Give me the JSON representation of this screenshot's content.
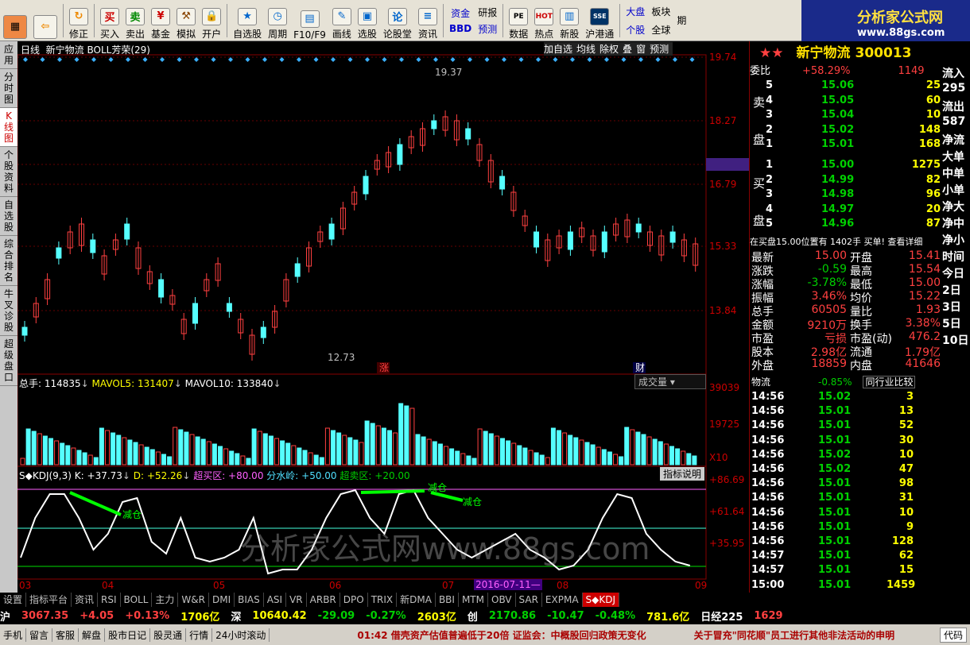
{
  "toolbar": {
    "buttons": [
      "修正",
      "买入",
      "卖出",
      "基金",
      "模拟",
      "开户",
      "自选股",
      "周期",
      "F10/F9",
      "画线",
      "选股",
      "论股堂",
      "资讯",
      "资金",
      "BBD",
      "研报",
      "预测",
      "数据",
      "热点",
      "新股",
      "沪港通",
      "大盘",
      "个股",
      "板块",
      "全球",
      "期"
    ],
    "brand": "分析家公式网",
    "brand_url": "www.88gs.com"
  },
  "leftnav": [
    "应用",
    "分时图",
    "K线图",
    "个股资料",
    "自选股",
    "综合排名",
    "牛叉诊股",
    "超级盘口"
  ],
  "chart": {
    "period": "日线",
    "name": "新宁物流",
    "indicator": "BOLL芳荣(29)",
    "tools": [
      "加自选",
      "均线",
      "除权",
      "叠",
      "窗",
      "预测"
    ],
    "price_axis": [
      "19.74",
      "18.27",
      "17.22",
      "16.79",
      "15.33",
      "13.84"
    ],
    "high_label": "19.37",
    "low_label": "12.73",
    "marks": [
      "涨",
      "财"
    ],
    "vol_header": {
      "total": "总手: 114835",
      "ma5": "MAVOL5: 131407",
      "ma10": "MAVOL10: 133840"
    },
    "vol_select": "成交量",
    "vol_axis": [
      "39039",
      "19725",
      "X10"
    ],
    "kdj_header": {
      "name": "S◆KDJ(9,3)",
      "k": "K: +37.73",
      "d": "D: +52.26",
      "over": "超买区: +80.00",
      "mid": "分水岭: +50.00",
      "under": "超卖区: +20.00"
    },
    "kdj_btn": "指标说明",
    "kdj_axis": [
      "+86.69",
      "+61.64",
      "+35.95"
    ],
    "kdj_labels": [
      "减仓",
      "减仓",
      "减仓"
    ],
    "dates": [
      "03",
      "04",
      "05",
      "06",
      "07",
      "08",
      "09"
    ],
    "cursor_date": "2016-07-11—",
    "watermark": "分析家公式网www.88gs.com"
  },
  "quote": {
    "stars": "★★",
    "name": "新宁物流",
    "code": "300013",
    "weibi_label": "委比",
    "weibi": "+58.29%",
    "weibi_n": "1149",
    "sell_label": [
      "卖",
      "盘"
    ],
    "buy_label": [
      "买",
      "盘"
    ],
    "sells": [
      [
        "5",
        "15.06",
        "25"
      ],
      [
        "4",
        "15.05",
        "60"
      ],
      [
        "3",
        "15.04",
        "10"
      ],
      [
        "2",
        "15.02",
        "148"
      ],
      [
        "1",
        "15.01",
        "168"
      ]
    ],
    "buys": [
      [
        "1",
        "15.00",
        "1275"
      ],
      [
        "2",
        "14.99",
        "82"
      ],
      [
        "3",
        "14.98",
        "96"
      ],
      [
        "4",
        "14.97",
        "20"
      ],
      [
        "5",
        "14.96",
        "87"
      ]
    ],
    "notice": "在买盘15.00位置有 1402手 买单! 查看详细",
    "stats": [
      [
        "最新",
        "15.00",
        "开盘",
        "15.41"
      ],
      [
        "涨跌",
        "-0.59",
        "最高",
        "15.54"
      ],
      [
        "涨幅",
        "-3.78%",
        "最低",
        "15.00"
      ],
      [
        "振幅",
        "3.46%",
        "均价",
        "15.22"
      ],
      [
        "总手",
        "60505",
        "量比",
        "1.93"
      ],
      [
        "金额",
        "9210万",
        "换手",
        "3.38%"
      ],
      [
        "市盈",
        "亏损",
        "市盈(动)",
        "476.2"
      ],
      [
        "股本",
        "2.98亿",
        "流通",
        "1.79亿"
      ],
      [
        "外盘",
        "18859",
        "内盘",
        "41646"
      ]
    ],
    "sector": "物流",
    "sector_chg": "-0.85%",
    "compare": "同行业比较",
    "ticks": [
      [
        "14:56",
        "15.02",
        "3"
      ],
      [
        "14:56",
        "15.01",
        "13"
      ],
      [
        "14:56",
        "15.01",
        "52"
      ],
      [
        "14:56",
        "15.01",
        "30"
      ],
      [
        "14:56",
        "15.02",
        "10"
      ],
      [
        "14:56",
        "15.02",
        "47"
      ],
      [
        "14:56",
        "15.01",
        "98"
      ],
      [
        "14:56",
        "15.01",
        "31"
      ],
      [
        "14:56",
        "15.01",
        "10"
      ],
      [
        "14:56",
        "15.01",
        "9"
      ],
      [
        "14:56",
        "15.01",
        "128"
      ],
      [
        "14:57",
        "15.01",
        "62"
      ],
      [
        "14:57",
        "15.01",
        "15"
      ],
      [
        "15:00",
        "15.01",
        "1459"
      ]
    ],
    "side_trunc": [
      "流入",
      "295",
      "流出",
      "587",
      "净流",
      "大单",
      "中单",
      "小单",
      "净大",
      "净中",
      "净小",
      "时间",
      "今日",
      "2日",
      "3日",
      "5日",
      "10日"
    ]
  },
  "bottom_tabs": [
    "设置",
    "指标平台",
    "资讯",
    "RSI",
    "BOLL",
    "主力",
    "W&R",
    "DMI",
    "BIAS",
    "ASI",
    "VR",
    "ARBR",
    "DPO",
    "TRIX",
    "新DMA",
    "BBI",
    "MTM",
    "OBV",
    "SAR",
    "EXPMA",
    "S◆KDJ"
  ],
  "right_tabs": [
    "细",
    "诊",
    "分",
    "筹",
    "值",
    "指",
    "财"
  ],
  "status": {
    "sh": "沪",
    "sh_v": "3067.35",
    "sh_c": "+4.05",
    "sh_p": "+0.13%",
    "sh_a": "1706亿",
    "sz": "深",
    "sz_v": "10640.42",
    "sz_c": "-29.09",
    "sz_p": "-0.27%",
    "sz_a": "2603亿",
    "cy": "创",
    "cy_v": "2170.86",
    "cy_c": "-10.47",
    "cy_p": "-0.48%",
    "cy_a": "781.6亿",
    "nk": "日经225",
    "nk_v": "1629"
  },
  "footer": {
    "buttons": [
      "手机",
      "留言",
      "客服",
      "解盘",
      "股市日记",
      "股灵通",
      "行情",
      "24小时滚动"
    ],
    "ticker": "01:42 借壳资产估值普遍低于20倍 证监会：中概股回归政策无变化",
    "ticker2": "关于冒充\"同花顺\"员工进行其他非法活动的申明",
    "code": "代码"
  }
}
